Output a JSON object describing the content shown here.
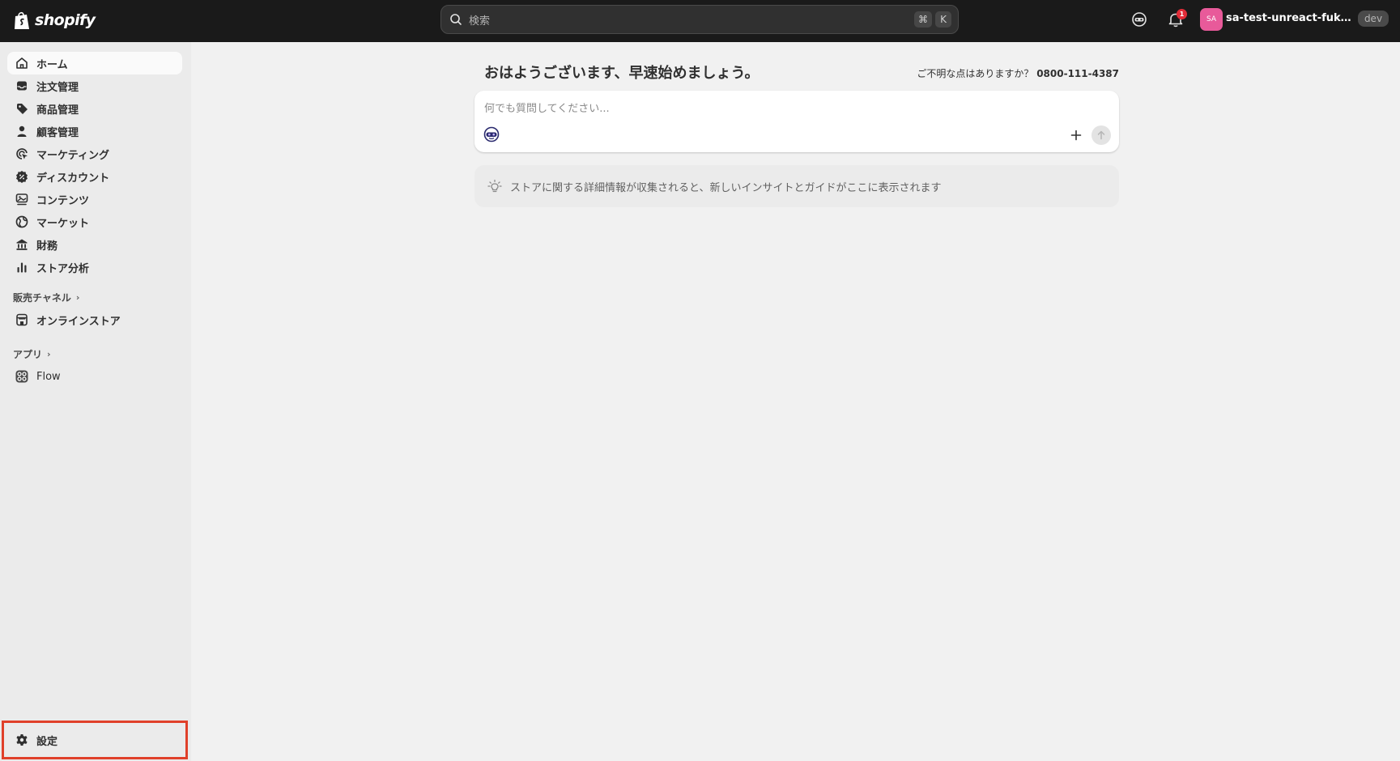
{
  "topbar": {
    "logo_text": "shopify",
    "search_placeholder": "検索",
    "shortcut_keys": [
      "⌘",
      "K"
    ],
    "notification_count": "1",
    "avatar_initials": "SA",
    "store_name": "sa-test-unreact-fukumot...",
    "env_badge": "dev"
  },
  "sidebar": {
    "items": [
      {
        "label": "ホーム",
        "icon": "home-icon",
        "active": true
      },
      {
        "label": "注文管理",
        "icon": "inbox-icon"
      },
      {
        "label": "商品管理",
        "icon": "tag-icon"
      },
      {
        "label": "顧客管理",
        "icon": "person-icon"
      },
      {
        "label": "マーケティング",
        "icon": "target-icon"
      },
      {
        "label": "ディスカウント",
        "icon": "discount-icon"
      },
      {
        "label": "コンテンツ",
        "icon": "content-icon"
      },
      {
        "label": "マーケット",
        "icon": "globe-icon"
      },
      {
        "label": "財務",
        "icon": "bank-icon"
      },
      {
        "label": "ストア分析",
        "icon": "chart-icon"
      }
    ],
    "sales_channels": {
      "heading": "販売チャネル",
      "items": [
        {
          "label": "オンラインストア",
          "icon": "store-icon"
        }
      ]
    },
    "apps": {
      "heading": "アプリ",
      "items": [
        {
          "label": "Flow",
          "icon": "flow-icon"
        }
      ]
    },
    "settings_label": "設定"
  },
  "main": {
    "greeting": "おはようございます、早速始めましょう。",
    "help_question": "ご不明な点はありますか？",
    "help_phone": "0800-111-4387",
    "ask_placeholder": "何でも質問してください...",
    "insight_text": "ストアに関する詳細情報が収集されると、新しいインサイトとガイドがここに表示されます"
  },
  "colors": {
    "topbar_bg": "#1a1a1a",
    "page_bg": "#f1f1f1",
    "sidebar_bg": "#ebebeb",
    "avatar_bg": "#e85a9a",
    "badge_red": "#e22c38",
    "highlight_border": "#e0402a"
  }
}
